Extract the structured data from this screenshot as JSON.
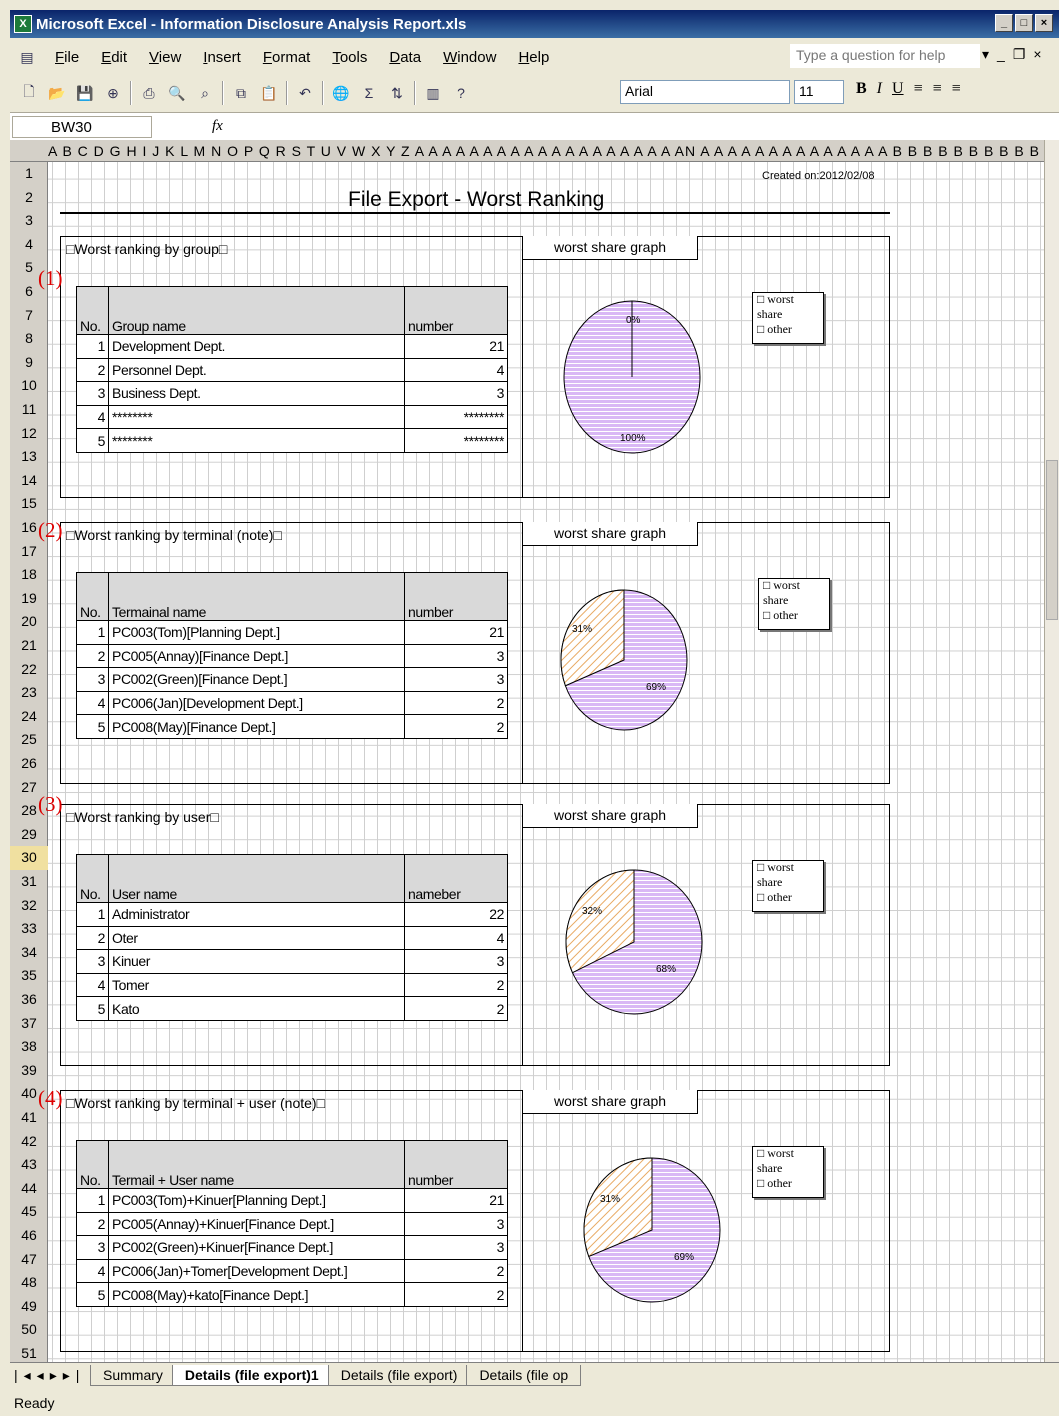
{
  "window": {
    "title": "Microsoft Excel - Information Disclosure Analysis Report.xls"
  },
  "menu": [
    "File",
    "Edit",
    "View",
    "Insert",
    "Format",
    "Tools",
    "Data",
    "Window",
    "Help"
  ],
  "help_placeholder": "Type a question for help",
  "toolbar": {
    "font": "Arial",
    "size": "11",
    "bold": "B",
    "italic": "I",
    "underline": "U"
  },
  "namebox": "BW30",
  "fx": "fx",
  "column_headers": "A B C D G H I J K L M N O P Q R S T U    V    W X Y Z A A A A A A A A A A A A A A A A A A A   AN  A A A A A A A A A A A A A A B B B B B B B B B B B B",
  "row_numbers": [
    "1",
    "2",
    "3",
    "4",
    "5",
    "6",
    "7",
    "8",
    "9",
    "10",
    "11",
    "12",
    "13",
    "14",
    "15",
    "16",
    "17",
    "18",
    "19",
    "20",
    "21",
    "22",
    "23",
    "24",
    "25",
    "26",
    "27",
    "28",
    "29",
    "30",
    "31",
    "32",
    "33",
    "34",
    "35",
    "36",
    "37",
    "38",
    "39",
    "40",
    "41",
    "42",
    "43",
    "44",
    "45",
    "46",
    "47",
    "48",
    "49",
    "50",
    "51"
  ],
  "selected_row": "30",
  "report": {
    "title": "File Export - Worst Ranking",
    "created": "Created on:2012/02/08",
    "graph_label": "worst share graph",
    "sections": [
      {
        "marker": "(1)",
        "label": "□Worst ranking by group□",
        "headers": [
          "No.",
          "Group name",
          "number"
        ],
        "rows": [
          [
            "1",
            "Development Dept.",
            "21"
          ],
          [
            "2",
            "Personnel Dept.",
            "4"
          ],
          [
            "3",
            "Business Dept.",
            "3"
          ],
          [
            "4",
            "********",
            "********"
          ],
          [
            "5",
            "********",
            "********"
          ]
        ],
        "legend": [
          "□ worst share",
          "□ other"
        ],
        "chart_labels": [
          "0%",
          "100%"
        ]
      },
      {
        "marker": "(2)",
        "label": "□Worst ranking by terminal (note)□",
        "headers": [
          "No.",
          "Termainal name",
          "number"
        ],
        "rows": [
          [
            "1",
            "PC003(Tom)[Planning Dept.]",
            "21"
          ],
          [
            "2",
            "PC005(Annay)[Finance Dept.]",
            "3"
          ],
          [
            "3",
            "PC002(Green)[Finance Dept.]",
            "3"
          ],
          [
            "4",
            "PC006(Jan)[Development Dept.]",
            "2"
          ],
          [
            "5",
            "PC008(May)[Finance Dept.]",
            "2"
          ]
        ],
        "legend": [
          "□ worst share",
          "□ other"
        ],
        "chart_labels": [
          "31%",
          "69%"
        ]
      },
      {
        "marker": "(3)",
        "label": "□Worst ranking by user□",
        "headers": [
          "No.",
          "User name",
          "nameber"
        ],
        "rows": [
          [
            "1",
            "Administrator",
            "22"
          ],
          [
            "2",
            "Oter",
            "4"
          ],
          [
            "3",
            "Kinuer",
            "3"
          ],
          [
            "4",
            "Tomer",
            "2"
          ],
          [
            "5",
            "Kato",
            "2"
          ]
        ],
        "legend": [
          "□ worst share",
          "□ other"
        ],
        "chart_labels": [
          "32%",
          "68%"
        ]
      },
      {
        "marker": "(4)",
        "label": "□Worst ranking by terminal + user (note)□",
        "headers": [
          "No.",
          "Termail + User name",
          "number"
        ],
        "rows": [
          [
            "1",
            "PC003(Tom)+Kinuer[Planning Dept.]",
            "21"
          ],
          [
            "2",
            "PC005(Annay)+Kinuer[Finance Dept.]",
            "3"
          ],
          [
            "3",
            "PC002(Green)+Kinuer[Finance Dept.]",
            "3"
          ],
          [
            "4",
            "PC006(Jan)+Tomer[Development Dept.]",
            "2"
          ],
          [
            "5",
            "PC008(May)+kato[Finance Dept.]",
            "2"
          ]
        ],
        "legend": [
          "□ worst share",
          "□ other"
        ],
        "chart_labels": [
          "31%",
          "69%"
        ]
      }
    ]
  },
  "tabs": [
    "Summary",
    "Details (file export)1",
    "Details (file export)",
    "Details (file op"
  ],
  "active_tab": "Details (file export)1",
  "status": "Ready",
  "colors": {
    "pie_other": "#d9b8f5",
    "pie_worst": "#f5d6a8",
    "titlebar": "#0a246a",
    "marker": "#dd0000"
  }
}
